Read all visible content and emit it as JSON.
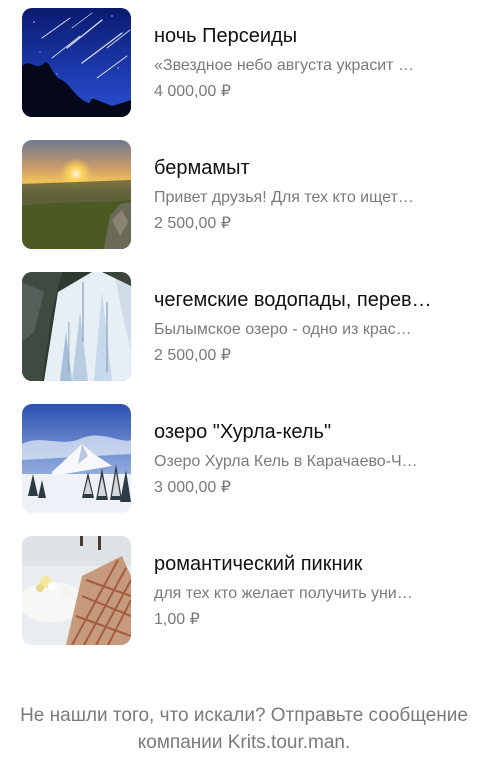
{
  "products": [
    {
      "title": "ночь Персеиды",
      "description": "«Звездное небо августа украсит …",
      "price": "4 000,00 ₽",
      "image": "meteor-night-sky"
    },
    {
      "title": "бермамыт",
      "description": "Привет друзья! Для тех кто ищет…",
      "price": "2 500,00 ₽",
      "image": "sunset-plateau"
    },
    {
      "title": "чегемские водопады, перев…",
      "description": "Былымское озеро - одно из крас…",
      "price": "2 500,00 ₽",
      "image": "frozen-waterfall"
    },
    {
      "title": "озеро \"Хурла-кель\"",
      "description": "Озеро Хурла Кель в Карачаево-Ч…",
      "price": "3 000,00 ₽",
      "image": "snowy-mountain-forest"
    },
    {
      "title": "романтический пикник",
      "description": "для тех кто желает получить уни…",
      "price": "1,00 ₽",
      "image": "picnic-table"
    }
  ],
  "footer": {
    "message": "Не нашли того, что искали? Отправьте сообщение компании Krits.tour.man."
  }
}
